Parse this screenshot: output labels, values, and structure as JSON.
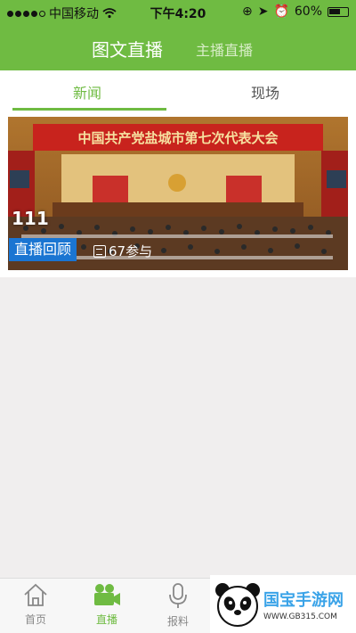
{
  "status_bar": {
    "carrier": "中国移动",
    "time": "下午4:20",
    "battery": "60%"
  },
  "header": {
    "tabs": [
      {
        "label": "图文直播",
        "active": true
      },
      {
        "label": "主播直播",
        "active": false
      }
    ]
  },
  "subtabs": [
    {
      "label": "新闻",
      "active": true
    },
    {
      "label": "现场",
      "active": false
    }
  ],
  "live_item": {
    "title": "111",
    "badge": "直播回顾",
    "participants": "67参与",
    "banner_text": "中国共产党盐城市第七次代表大会"
  },
  "tabbar": [
    {
      "label": "首页",
      "icon": "home-icon",
      "active": false
    },
    {
      "label": "直播",
      "icon": "video-camera-icon",
      "active": true
    },
    {
      "label": "报料",
      "icon": "microphone-icon",
      "active": false
    }
  ],
  "watermark": {
    "text": "国宝手游网",
    "url": "WWW.GB315.COM"
  },
  "colors": {
    "accent": "#6fbb42",
    "badge": "#1a75d2"
  }
}
